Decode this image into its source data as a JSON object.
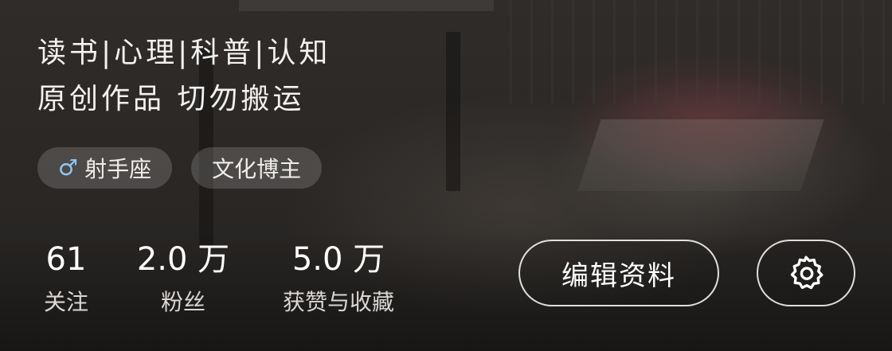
{
  "bio": {
    "line1": "读书|心理|科普|认知",
    "line2": "原创作品 切勿搬运"
  },
  "tags": [
    {
      "icon": "male-icon",
      "icon_glyph": "♂",
      "label": "射手座"
    },
    {
      "label": "文化博主"
    }
  ],
  "stats": {
    "following": {
      "value": "61",
      "label": "关注"
    },
    "followers": {
      "value": "2.0 万",
      "label": "粉丝"
    },
    "likes_and_collections": {
      "value": "5.0 万",
      "label": "获赞与收藏"
    }
  },
  "actions": {
    "edit_profile_label": "编辑资料",
    "settings_icon": "gear-icon"
  },
  "colors": {
    "gender_icon": "#8fc6f5",
    "text": "#ffffff"
  }
}
